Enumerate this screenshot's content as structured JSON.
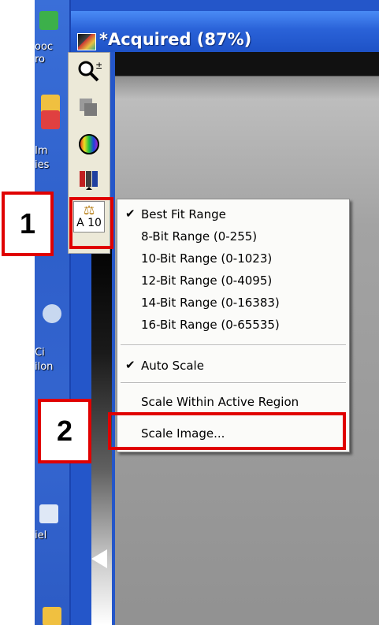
{
  "desktop": {
    "labels": [
      "ooc",
      "ro",
      "Im",
      "ies",
      "Ci",
      "ilon",
      "iel"
    ]
  },
  "window": {
    "title": "*Acquired (87%)"
  },
  "toolbar": {
    "tools": [
      {
        "icon": "zoom-icon"
      },
      {
        "icon": "layers-icon"
      },
      {
        "icon": "color-wheel-icon"
      },
      {
        "icon": "lut-icon"
      },
      {
        "icon": "scale-icon",
        "label": "A 10"
      }
    ]
  },
  "annotations": {
    "step1": "1",
    "step2": "2",
    "colors": {
      "red": "#e00000"
    }
  },
  "menu": {
    "items": [
      {
        "label": "Best Fit Range",
        "checked": true
      },
      {
        "label": "8-Bit Range (0-255)",
        "checked": false
      },
      {
        "label": "10-Bit Range (0-1023)",
        "checked": false
      },
      {
        "label": "12-Bit Range (0-4095)",
        "checked": false
      },
      {
        "label": "14-Bit Range (0-16383)",
        "checked": false
      },
      {
        "label": "16-Bit Range (0-65535)",
        "checked": false
      },
      {
        "label": "Auto Scale",
        "checked": true
      },
      {
        "label": "Scale Within Active Region",
        "checked": false
      },
      {
        "label": "Scale Image...",
        "checked": false
      }
    ],
    "check_glyph": "✔"
  }
}
